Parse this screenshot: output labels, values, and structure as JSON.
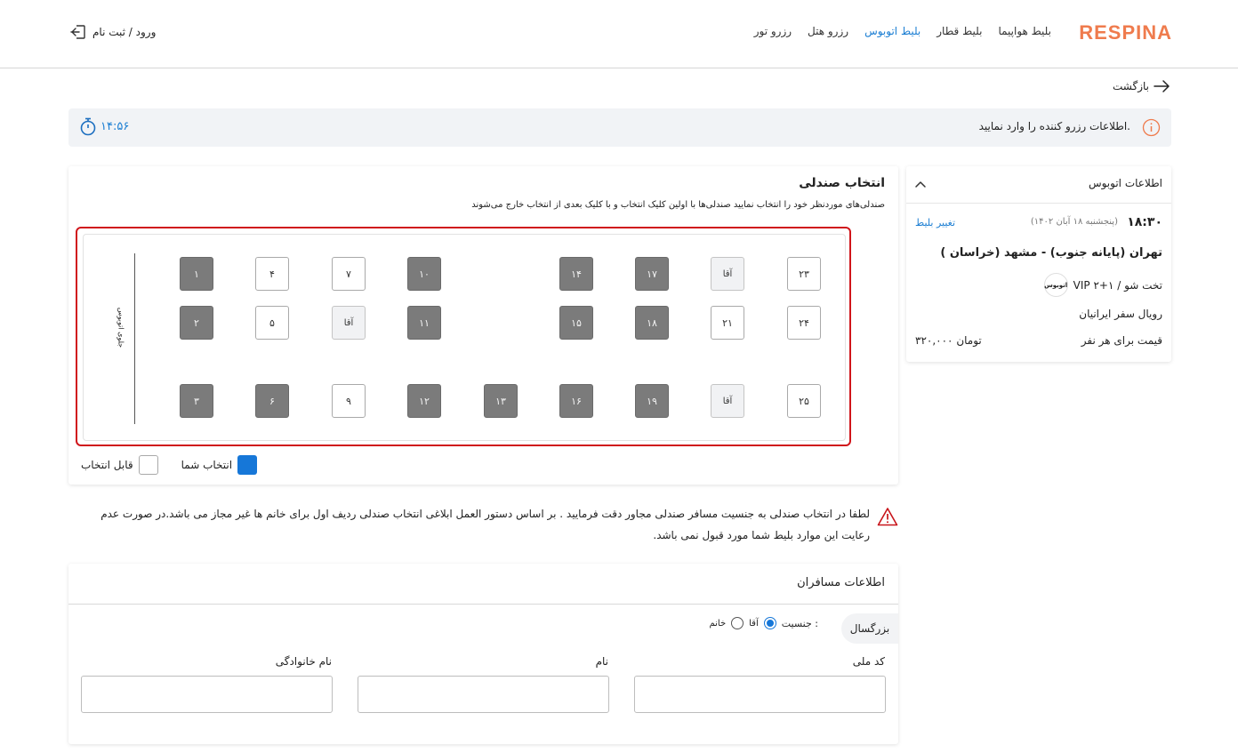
{
  "header": {
    "logo": "RESPINA",
    "nav": [
      {
        "label": "بلیط هواپیما",
        "active": false
      },
      {
        "label": "بلیط قطار",
        "active": false
      },
      {
        "label": "بلیط اتوبوس",
        "active": true
      },
      {
        "label": "رزرو هتل",
        "active": false
      },
      {
        "label": "رزرو تور",
        "active": false
      }
    ],
    "login_label": "ورود / ثبت نام",
    "login_icon": "login-icon"
  },
  "back": {
    "label": "بازگشت",
    "icon": "arrow-right-icon"
  },
  "banner": {
    "text": "اطلاعات رزرو کننده را وارد نمایید.",
    "icon": "info-icon",
    "timer": "۱۴:۵۶",
    "timer_icon": "stopwatch-icon"
  },
  "seat_selection": {
    "title": "انتخاب صندلی",
    "subtitle": "صندلی‌های موردنظر خود را انتخاب نمایید صندلی‌ها با اولین کلیک انتخاب و با کلیک بعدی از انتخاب خارج می‌شوند",
    "front_label": "جلوی اتوبوس",
    "seats": [
      {
        "label": "۱",
        "status": "occupied"
      },
      {
        "label": "۲",
        "status": "occupied"
      },
      {
        "label": "۳",
        "status": "occupied"
      },
      {
        "label": "۴",
        "status": "available"
      },
      {
        "label": "۵",
        "status": "available"
      },
      {
        "label": "۶",
        "status": "occupied"
      },
      {
        "label": "۷",
        "status": "available"
      },
      {
        "label": "آقا",
        "status": "male"
      },
      {
        "label": "۹",
        "status": "available"
      },
      {
        "label": "۱۰",
        "status": "occupied"
      },
      {
        "label": "۱۱",
        "status": "occupied"
      },
      {
        "label": "۱۲",
        "status": "occupied"
      },
      {
        "label": "۱۳",
        "status": "occupied"
      },
      {
        "label": "۱۴",
        "status": "occupied"
      },
      {
        "label": "۱۵",
        "status": "occupied"
      },
      {
        "label": "۱۶",
        "status": "occupied"
      },
      {
        "label": "۱۷",
        "status": "occupied"
      },
      {
        "label": "۱۸",
        "status": "occupied"
      },
      {
        "label": "۱۹",
        "status": "occupied"
      },
      {
        "label": "آقا",
        "status": "male"
      },
      {
        "label": "۲۱",
        "status": "available"
      },
      {
        "label": "آقا",
        "status": "male"
      },
      {
        "label": "۲۳",
        "status": "available"
      },
      {
        "label": "۲۴",
        "status": "available"
      },
      {
        "label": "۲۵",
        "status": "available"
      }
    ],
    "legend": {
      "available_label": "قابل انتخاب",
      "mine_label": "انتخاب شما",
      "mine_color": "#1677d8"
    }
  },
  "bus_info": {
    "title": "اطلاعات اتوبوس",
    "chevron_icon": "chevron-up-icon",
    "time": "۱۸:۳۰",
    "date": "(۱۴۰۲ پنجشنبه ۱۸ آبان)",
    "change_label": "تغییر بلیط",
    "route": "تهران (پایانه جنوب) - مشهد (خراسان )",
    "logo_text": "اتوبوس",
    "class_label": "VIP ۲+۱ / تخت شو",
    "company": "رویال سفر ایرانیان",
    "price_label": "قیمت برای هر نفر",
    "price": "۳۲۰,۰۰۰ تومان"
  },
  "warning": {
    "icon": "warning-icon",
    "text": "لطفا در انتخاب صندلی به جنسیت مسافر صندلی مجاور دقت فرمایید . بر اساس دستور العمل ابلاغی انتخاب صندلی ردیف اول برای خانم ها غیر مجاز می باشد.در صورت عدم رعایت این موارد بلیط شما مورد قبول نمی باشد."
  },
  "passengers": {
    "title": "اطلاعات مسافران",
    "adult_tab": "بزرگسال",
    "gender_label": "جنسیت :",
    "gender_options": [
      {
        "label": "آقا",
        "checked": true
      },
      {
        "label": "خانم",
        "checked": false
      }
    ],
    "fields": [
      {
        "label": "کد ملی",
        "value": ""
      },
      {
        "label": "نام",
        "value": ""
      },
      {
        "label": "نام خانوادگی",
        "value": ""
      }
    ]
  }
}
